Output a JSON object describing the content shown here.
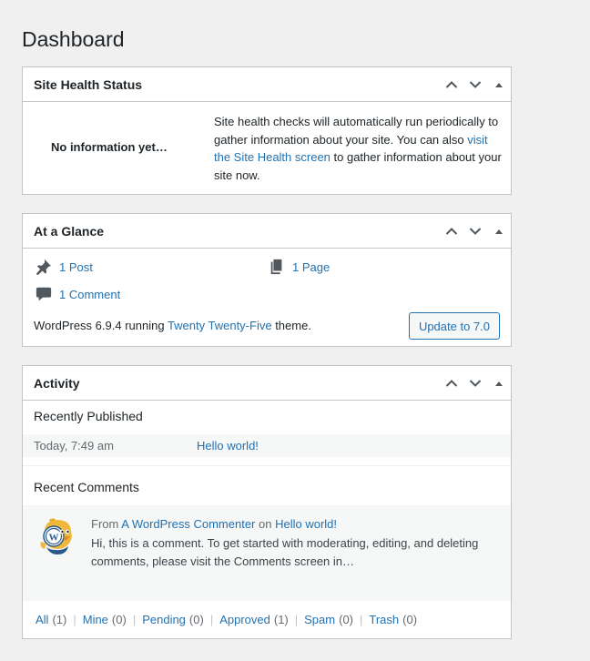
{
  "page": {
    "title": "Dashboard"
  },
  "site_health": {
    "title": "Site Health Status",
    "status": "No information yet…",
    "desc_before": "Site health checks will automatically run periodically to gather information about your site. You can also ",
    "desc_link": "visit the Site Health screen",
    "desc_after": " to gather information about your site now."
  },
  "glance": {
    "title": "At a Glance",
    "posts": "1 Post",
    "pages": "1 Page",
    "comments": "1 Comment",
    "footer_before": "WordPress 6.9.4 running ",
    "theme": "Twenty Twenty-Five",
    "footer_after": " theme.",
    "update_button": "Update to 7.0"
  },
  "activity": {
    "title": "Activity",
    "recently_published_title": "Recently Published",
    "published": [
      {
        "date": "Today, 7:49 am",
        "title": "Hello world!"
      }
    ],
    "recent_comments_title": "Recent Comments",
    "comment": {
      "from_label": "From",
      "author": "A WordPress Commenter",
      "on_label": "on",
      "post": "Hello world!",
      "text": "Hi, this is a comment. To get started with moderating, editing, and deleting comments, please visit the Comments screen in…"
    },
    "filters": [
      {
        "label": "All",
        "count": "(1)"
      },
      {
        "label": "Mine",
        "count": "(0)"
      },
      {
        "label": "Pending",
        "count": "(0)"
      },
      {
        "label": "Approved",
        "count": "(1)"
      },
      {
        "label": "Spam",
        "count": "(0)"
      },
      {
        "label": "Trash",
        "count": "(0)"
      }
    ]
  },
  "colors": {
    "link": "#2271b1",
    "border": "#c3c4c7",
    "background": "#f0f0f1"
  },
  "icons": {
    "move_up": "chevron-up-icon",
    "move_down": "chevron-down-icon",
    "toggle": "triangle-up-icon",
    "post": "pushpin-icon",
    "page": "pages-icon",
    "comment": "speech-bubble-icon"
  }
}
